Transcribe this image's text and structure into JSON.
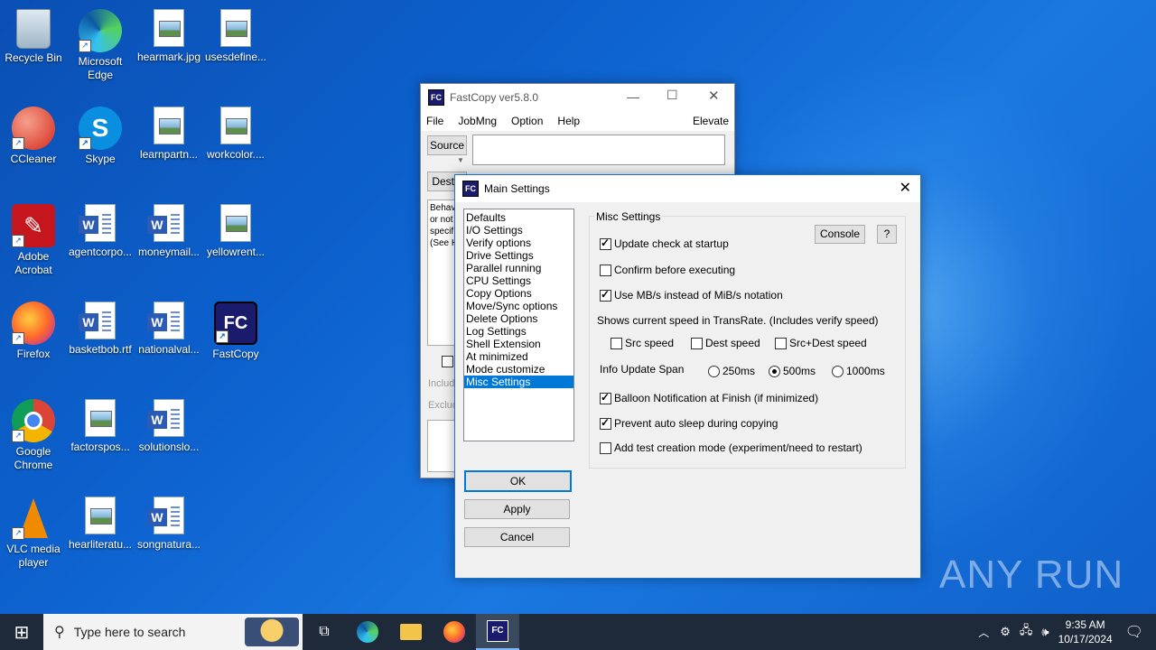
{
  "desktop": {
    "icons": [
      {
        "label": "Recycle Bin"
      },
      {
        "label": "Microsoft Edge"
      },
      {
        "label": "hearmark.jpg"
      },
      {
        "label": "usesdefine..."
      },
      {
        "label": "CCleaner"
      },
      {
        "label": "Skype"
      },
      {
        "label": "learnpartn..."
      },
      {
        "label": "workcolor...."
      },
      {
        "label": "Adobe Acrobat"
      },
      {
        "label": "agentcorpo..."
      },
      {
        "label": "moneymail..."
      },
      {
        "label": "yellowrent..."
      },
      {
        "label": "Firefox"
      },
      {
        "label": "basketbob.rtf"
      },
      {
        "label": "nationalval..."
      },
      {
        "label": "FastCopy"
      },
      {
        "label": "Google Chrome"
      },
      {
        "label": "factorspos..."
      },
      {
        "label": "solutionslo..."
      },
      {
        "label": "VLC media player"
      },
      {
        "label": "hearliteratu..."
      },
      {
        "label": "songnatura..."
      }
    ]
  },
  "fastcopy": {
    "title": "FastCopy ver5.8.0",
    "icon_text": "FC",
    "menu": [
      "File",
      "JobMng",
      "Option",
      "Help"
    ],
    "elevate": "Elevate",
    "source_btn": "Source",
    "dest_btn": "DestD",
    "behavior_text": [
      "Behav",
      "or not",
      "specif",
      "(See H"
    ],
    "include_label": "Includ",
    "exclude_label": "Exclud"
  },
  "settings": {
    "title": "Main Settings",
    "nav": [
      "Defaults",
      "I/O Settings",
      "Verify options",
      "Drive Settings",
      "Parallel running",
      "CPU Settings",
      "Copy Options",
      "Move/Sync options",
      "Delete Options",
      "Log Settings",
      "Shell Extension",
      "At minimized",
      "Mode customize",
      "Misc Settings"
    ],
    "selected_index": 13,
    "group_title": "Misc Settings",
    "console_btn": "Console",
    "help_btn": "?",
    "update_check": {
      "label": "Update check at startup",
      "checked": true
    },
    "confirm": {
      "label": "Confirm before executing",
      "checked": false
    },
    "mbs": {
      "label": "Use MB/s instead of MiB/s notation",
      "checked": true
    },
    "speed_note": "Shows current speed in TransRate. (Includes verify speed)",
    "src_speed": {
      "label": "Src speed",
      "checked": false
    },
    "dest_speed": {
      "label": "Dest speed",
      "checked": false
    },
    "srcdest_speed": {
      "label": "Src+Dest speed",
      "checked": false
    },
    "info_span_label": "Info Update Span",
    "span_options": [
      "250ms",
      "500ms",
      "1000ms"
    ],
    "span_selected": "500ms",
    "balloon": {
      "label": "Balloon Notification at Finish (if minimized)",
      "checked": true
    },
    "prevent_sleep": {
      "label": "Prevent auto sleep during copying",
      "checked": true
    },
    "test_mode": {
      "label": "Add test creation mode (experiment/need to restart)",
      "checked": false
    },
    "ok": "OK",
    "apply": "Apply",
    "cancel": "Cancel"
  },
  "taskbar": {
    "search_placeholder": "Type here to search",
    "time": "9:35 AM",
    "date": "10/17/2024"
  },
  "watermark": "ANY RUN"
}
